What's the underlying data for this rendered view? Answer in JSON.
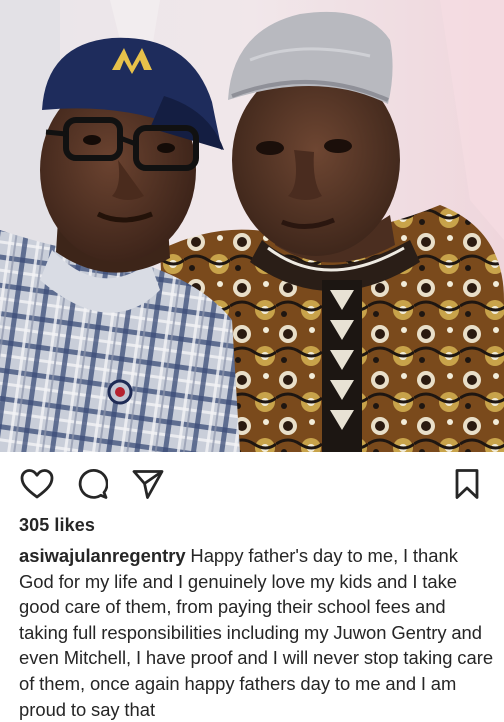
{
  "post": {
    "image_description_icon": "photo-of-two-men",
    "actions": {
      "like_icon": "heart-outline-icon",
      "comment_icon": "comment-bubble-icon",
      "share_icon": "paper-plane-icon",
      "save_icon": "bookmark-icon"
    },
    "likes_text": "305 likes",
    "caption": {
      "username": "asiwajulanregentry",
      "text": "Happy father's day to me, I thank God for my life and I genuinely love my kids and I take good care of them, from paying their school fees and taking full responsibilities including my Juwon Gentry and even Mitchell, I have proof and I will never stop taking care of them, once again happy fathers day to me and I am proud to say that"
    }
  },
  "colors": {
    "text": "#262626",
    "background": "#ffffff"
  }
}
